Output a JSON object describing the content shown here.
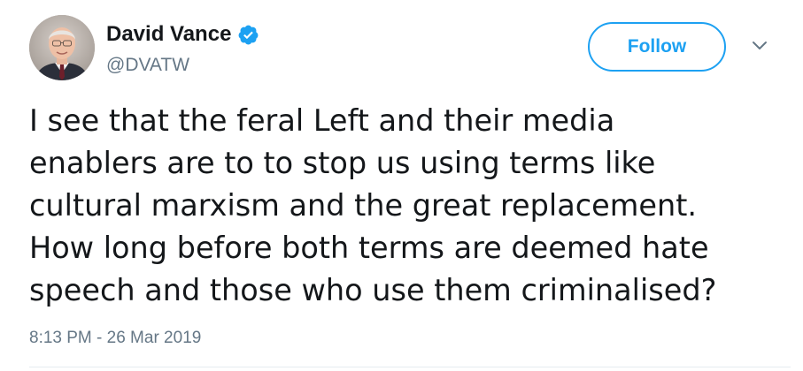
{
  "tweet": {
    "author": {
      "display_name": "David Vance",
      "handle": "@DVATW",
      "verified": true,
      "avatar_icon": "user-avatar-photo"
    },
    "follow_button": {
      "label": "Follow"
    },
    "menu_icon": "chevron-down-icon",
    "text_lines": [
      "I see that the feral Left and their media",
      "enablers are to to stop us using terms like",
      "cultural marxism and the great replacement.",
      "How long before both terms are deemed hate",
      "speech and those who use them criminalised?"
    ],
    "timestamp": "8:13 PM - 26 Mar 2019"
  },
  "colors": {
    "accent": "#1da1f2",
    "text_primary": "#14171a",
    "text_secondary": "#657786",
    "divider": "#e6ecf0"
  }
}
